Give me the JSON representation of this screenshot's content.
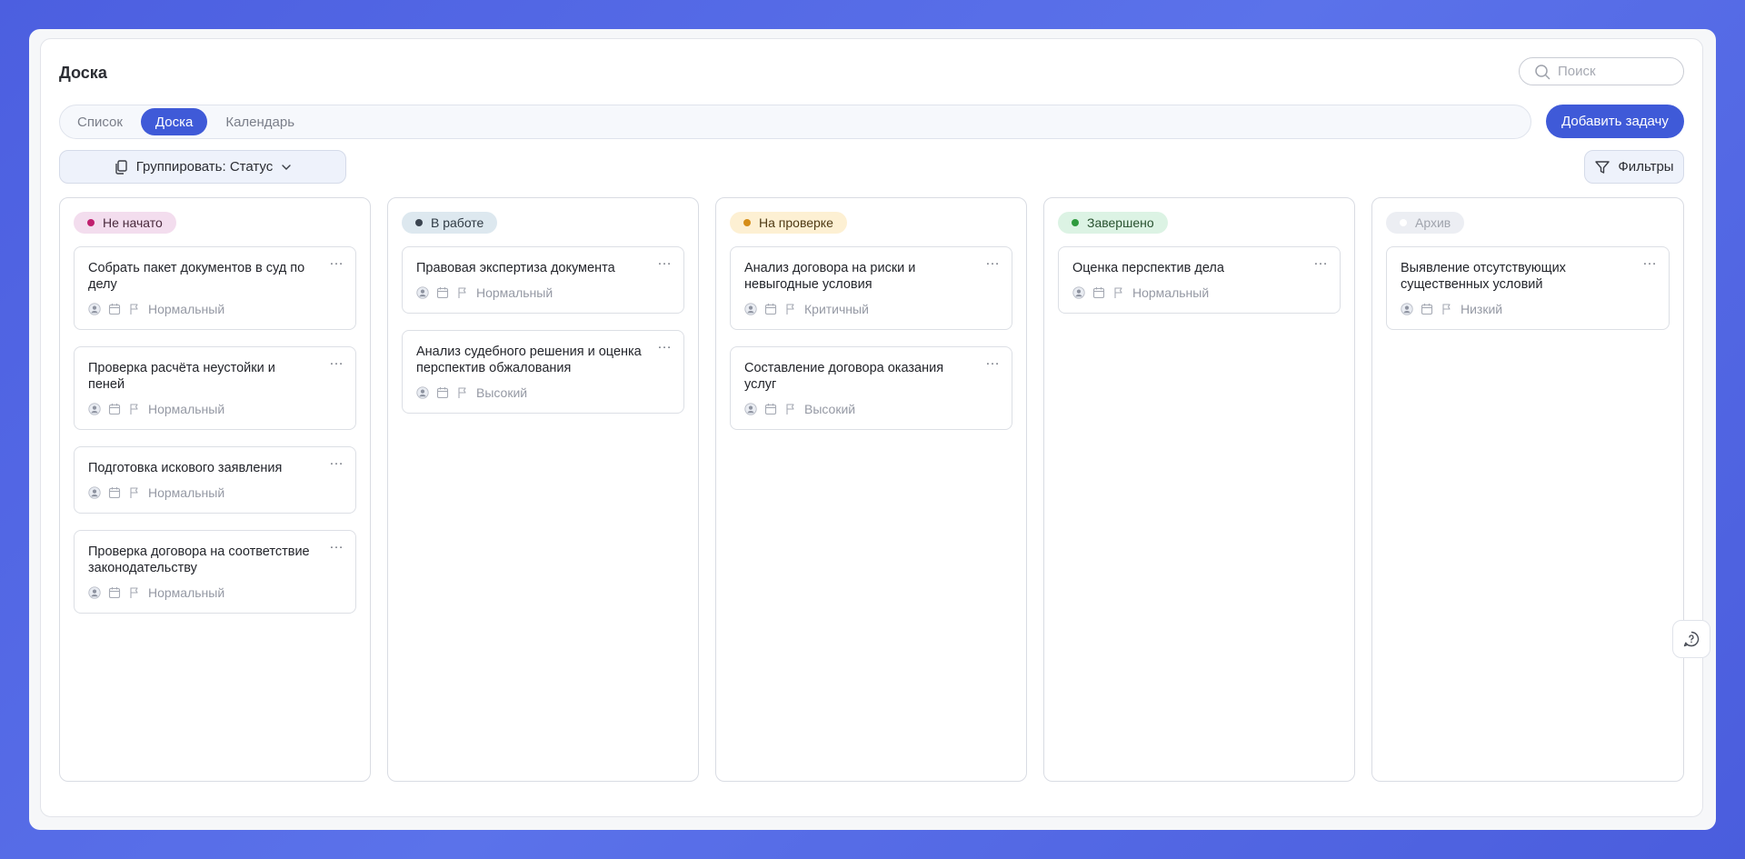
{
  "header": {
    "title": "Доска",
    "search_placeholder": "Поиск"
  },
  "tabs": [
    {
      "label": "Список",
      "active": false
    },
    {
      "label": "Доска",
      "active": true
    },
    {
      "label": "Календарь",
      "active": false
    }
  ],
  "toolbar": {
    "add_task_label": "Добавить задачу",
    "group_by_label": "Группировать: Статус",
    "filters_label": "Фильтры"
  },
  "colors": {
    "accent": "#3f5ad8",
    "not_started_bg": "#f3ddee",
    "not_started_dot": "#c0206e",
    "not_started_text": "#4a2a3c",
    "in_progress_bg": "#dde8ef",
    "in_progress_dot": "#3b4450",
    "in_progress_text": "#2f3a44",
    "review_bg": "#fdf0d3",
    "review_dot": "#d58d18",
    "review_text": "#4e3a14",
    "done_bg": "#dcf3e4",
    "done_dot": "#2f9a3e",
    "done_text": "#28512f",
    "archive_bg": "#eceef3",
    "archive_dot": "#ffffff",
    "archive_text": "#a0a4ad"
  },
  "columns": [
    {
      "status": "Не начато",
      "cards": [
        {
          "title": "Собрать пакет документов в суд по делу",
          "priority": "Нормальный"
        },
        {
          "title": "Проверка расчёта неустойки и пеней",
          "priority": "Нормальный"
        },
        {
          "title": "Подготовка искового заявления",
          "priority": "Нормальный"
        },
        {
          "title": "Проверка договора на соответствие законодательству",
          "priority": "Нормальный"
        }
      ]
    },
    {
      "status": "В работе",
      "cards": [
        {
          "title": "Правовая экспертиза документа",
          "priority": "Нормальный"
        },
        {
          "title": "Анализ судебного решения и оценка перспектив обжалования",
          "priority": "Высокий"
        }
      ]
    },
    {
      "status": "На проверке",
      "cards": [
        {
          "title": "Анализ договора на риски и невыгодные условия",
          "priority": "Критичный"
        },
        {
          "title": "Составление договора оказания услуг",
          "priority": "Высокий"
        }
      ]
    },
    {
      "status": "Завершено",
      "cards": [
        {
          "title": "Оценка перспектив дела",
          "priority": "Нормальный"
        }
      ]
    },
    {
      "status": "Архив",
      "cards": [
        {
          "title": "Выявление отсутствующих существенных условий",
          "priority": "Низкий"
        }
      ]
    }
  ],
  "icons": {
    "search": "search-icon",
    "group": "copy-icon",
    "chevron": "chevron-down-icon",
    "filter": "filter-icon",
    "assignee": "user-icon",
    "date": "calendar-icon",
    "priority": "flag-icon",
    "menu": "more-horizontal-icon",
    "help": "chat-help-icon"
  }
}
